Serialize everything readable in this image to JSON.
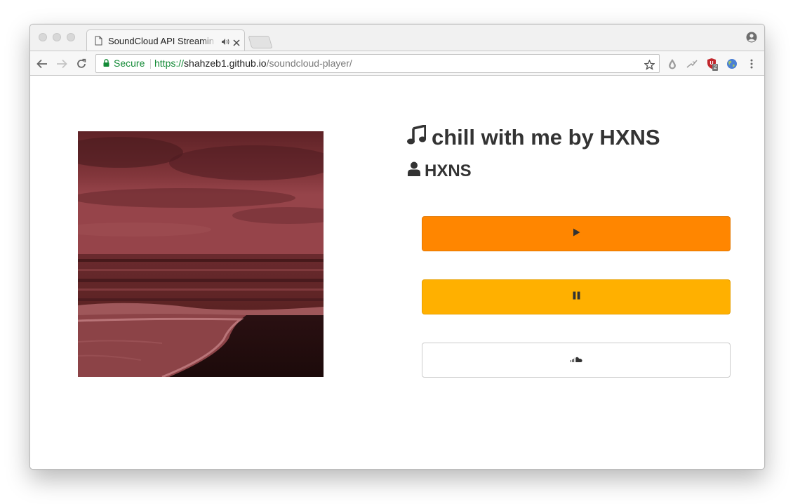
{
  "browser": {
    "tab": {
      "title": "SoundCloud API Streaming",
      "audio_icon": "speaker-icon",
      "close_icon": "close-icon"
    },
    "address": {
      "secure_label": "Secure",
      "url_scheme": "https://",
      "url_host": "shahzeb1.github.io",
      "url_path": "/soundcloud-player/"
    },
    "extensions": {
      "badge_count": "2"
    }
  },
  "player": {
    "track_title": "chill with me by HXNS",
    "artist": "HXNS",
    "buttons": {
      "play_icon": "play-icon",
      "pause_icon": "pause-icon",
      "soundcloud_icon": "soundcloud-icon"
    }
  },
  "colors": {
    "play_button": "#ff8600",
    "pause_button": "#ffb000",
    "text": "#333333",
    "secure_green": "#138a36",
    "artwork_tint": "#8f3338"
  }
}
